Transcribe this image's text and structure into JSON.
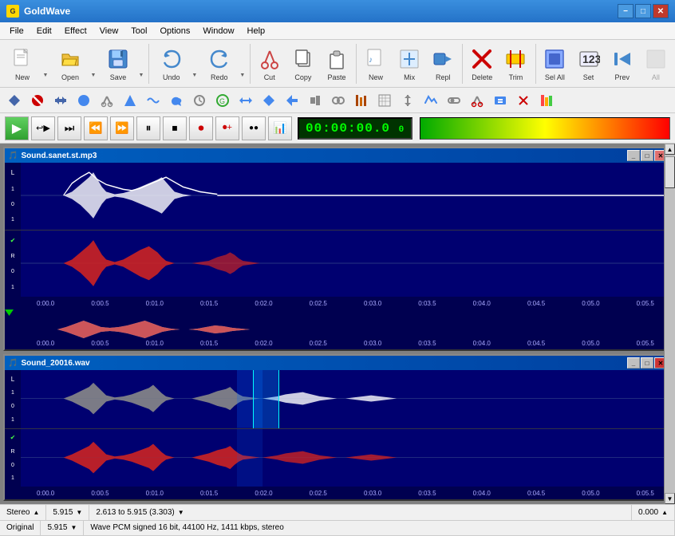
{
  "titlebar": {
    "title": "GoldWave",
    "min_label": "−",
    "max_label": "□",
    "close_label": "✕"
  },
  "menubar": {
    "items": [
      "File",
      "Edit",
      "Effect",
      "View",
      "Tool",
      "Options",
      "Window",
      "Help"
    ]
  },
  "toolbar1": {
    "buttons": [
      {
        "id": "new",
        "label": "New",
        "icon": "📄"
      },
      {
        "id": "open",
        "label": "Open",
        "icon": "📂"
      },
      {
        "id": "save",
        "label": "Save",
        "icon": "💾"
      },
      {
        "id": "undo",
        "label": "Undo",
        "icon": "↩"
      },
      {
        "id": "redo",
        "label": "Redo",
        "icon": "↪"
      },
      {
        "id": "cut",
        "label": "Cut",
        "icon": "✂"
      },
      {
        "id": "copy",
        "label": "Copy",
        "icon": "📋"
      },
      {
        "id": "paste",
        "label": "Paste",
        "icon": "📌"
      },
      {
        "id": "new2",
        "label": "New",
        "icon": "🎵"
      },
      {
        "id": "mix",
        "label": "Mix",
        "icon": "🎚"
      },
      {
        "id": "repl",
        "label": "Repl",
        "icon": "🔁"
      },
      {
        "id": "delete",
        "label": "Delete",
        "icon": "✖"
      },
      {
        "id": "trim",
        "label": "Trim",
        "icon": "✂"
      },
      {
        "id": "selall",
        "label": "Sel All",
        "icon": "⬛"
      },
      {
        "id": "set",
        "label": "Set",
        "icon": "🔢"
      },
      {
        "id": "prev",
        "label": "Prev",
        "icon": "🔙"
      },
      {
        "id": "all",
        "label": "All",
        "icon": "📊"
      }
    ]
  },
  "toolbar2": {
    "buttons": [
      "⇐",
      "🚫",
      "⬌",
      "🔵",
      "✂",
      "➡",
      "〰",
      "↩",
      "⚙",
      "🌍",
      "↔",
      "➡",
      "⟵",
      "⬦",
      "⚙",
      "🎨",
      "▦",
      "⬌",
      "🔊",
      "🔊",
      "🎵",
      "🔶",
      "↔",
      "✖",
      "🌈"
    ]
  },
  "transport": {
    "play_icon": "▶",
    "loop_icon": "↩▶",
    "end_icon": "⏭",
    "rew_icon": "⏪",
    "ff_icon": "⏩",
    "pause_icon": "⏸",
    "stop_icon": "⏹",
    "rec_icon": "⏺",
    "rec2_icon": "⏺",
    "dots_icon": "•••",
    "monitor_icon": "📊",
    "time": "00:00:00.0",
    "time_suffix": "0"
  },
  "wave1": {
    "title": "Sound.sanet.st.mp3",
    "timeline_labels": [
      "0:00.0",
      "0:00.5",
      "0:01.0",
      "0:01.5",
      "0:02.0",
      "0:02.5",
      "0:03.0",
      "0:03.5",
      "0:04.0",
      "0:04.5",
      "0:05.0",
      "0:05.5"
    ],
    "overview_timeline": [
      "0:00.0",
      "0:00.5",
      "0:01.0",
      "0:01.5",
      "0:02.0",
      "0:02.5",
      "0:03.0",
      "0:03.5",
      "0:04.0",
      "0:04.5",
      "0:05.0",
      "0:05.5"
    ]
  },
  "wave2": {
    "title": "Sound_20016.wav",
    "timeline_labels": [
      "0:00.0",
      "0:00.5",
      "0:01.0",
      "0:01.5",
      "0:02.0",
      "0:02.5",
      "0:03.0",
      "0:03.5",
      "0:04.0",
      "0:04.5",
      "0:05.0",
      "0:05.5"
    ]
  },
  "statusbar": {
    "row1": {
      "channel": "Stereo",
      "channel_arrow": "▲",
      "length": "5.915",
      "length_arrow": "▼",
      "selection": "2.613 to 5.915 (3.303)",
      "selection_arrow": "▼",
      "value": "0.000",
      "value_arrow": "▲"
    },
    "row2": {
      "label": "Original",
      "length2": "5.915",
      "length2_arrow": "▼",
      "format": "Wave PCM signed 16 bit, 44100 Hz, 1411 kbps, stereo"
    }
  }
}
